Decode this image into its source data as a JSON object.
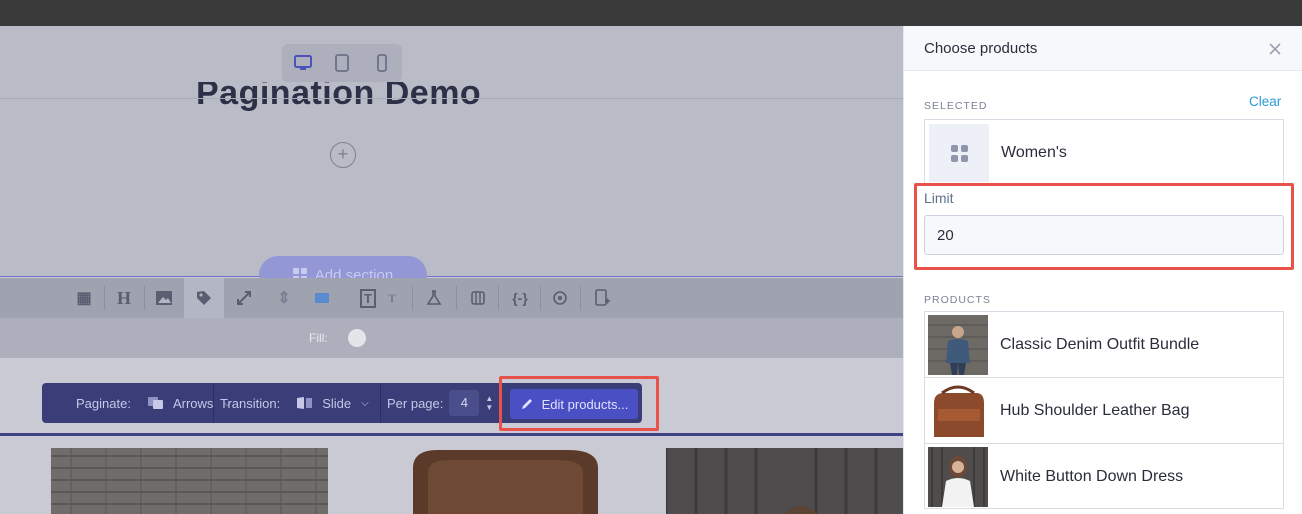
{
  "canvas": {
    "page_heading": "Pagination Demo",
    "add_section_label": "Add section",
    "fill_label": "Fill:",
    "pagination_bar": {
      "paginate_label": "Paginate:",
      "paginate_value": "Arrows",
      "transition_label": "Transition:",
      "transition_value": "Slide",
      "per_page_label": "Per page:",
      "per_page_value": "4",
      "edit_products_label": "Edit products..."
    },
    "colors": {
      "accent": "#4b4fc4",
      "highlight": "#e8524a"
    }
  },
  "panel": {
    "title": "Choose products",
    "selected_label": "SELECTED",
    "clear_label": "Clear",
    "selected_item": "Women's",
    "limit_label": "Limit",
    "limit_value": "20",
    "products_label": "PRODUCTS",
    "products": [
      {
        "name": "Classic Denim Outfit Bundle"
      },
      {
        "name": "Hub Shoulder Leather Bag"
      },
      {
        "name": "White Button Down Dress"
      }
    ],
    "colors": {
      "link": "#2a9bd6"
    }
  }
}
